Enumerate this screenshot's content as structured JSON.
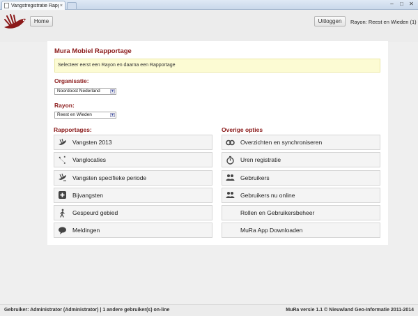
{
  "browser": {
    "tab_title": "Vangstregistratie Rappo",
    "tab_close": "×",
    "win_min": "–",
    "win_max": "□",
    "win_close": "✕"
  },
  "header": {
    "home_label": "Home",
    "logout_label": "Uitloggen",
    "rayon_text": "Rayon: Reest en Wieden (1)"
  },
  "main": {
    "title": "Mura Mobiel Rapportage",
    "notice": "Selecteer eerst een Rayon en daarna een Rapportage",
    "organisatie_label": "Organisatie:",
    "organisatie_value": "Noordoost Nederland",
    "rayon_label": "Rayon:",
    "rayon_value": "Reest en Wieden"
  },
  "rapportages": {
    "title": "Rapportages:",
    "items": [
      {
        "label": "Vangsten 2013",
        "icon": "muskrat-icon"
      },
      {
        "label": "Vanglocaties",
        "icon": "locations-icon"
      },
      {
        "label": "Vangsten specifieke periode",
        "icon": "muskrat-period-icon"
      },
      {
        "label": "Bijvangsten",
        "icon": "plus-icon"
      },
      {
        "label": "Gespeurd gebied",
        "icon": "walking-person-icon"
      },
      {
        "label": "Meldingen",
        "icon": "chat-icon"
      }
    ]
  },
  "overige": {
    "title": "Overige opties",
    "items": [
      {
        "label": "Overzichten en synchroniseren",
        "icon": "sync-icon"
      },
      {
        "label": "Uren registratie",
        "icon": "stopwatch-icon"
      },
      {
        "label": "Gebruikers",
        "icon": "users-icon"
      },
      {
        "label": "Gebruikers nu online",
        "icon": "users-online-icon"
      },
      {
        "label": "Rollen en Gebruikersbeheer",
        "icon": ""
      },
      {
        "label": "MuRa App Downloaden",
        "icon": ""
      }
    ]
  },
  "footer": {
    "left": "Gebruiker: Administrator (Administrator) | 1 andere gebruiker(s) on-line",
    "right": "MuRa versie 1.1 © Nieuwland Geo-Informatie 2011-2014"
  },
  "colors": {
    "accent": "#8b1a1a",
    "notice_bg": "#fcfbd3"
  }
}
